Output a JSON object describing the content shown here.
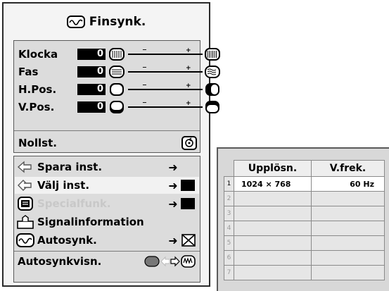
{
  "menu": {
    "title": "Finsynk.",
    "adjustments": [
      {
        "label": "Klocka",
        "value": "0"
      },
      {
        "label": "Fas",
        "value": "0"
      },
      {
        "label": "H.Pos.",
        "value": "0"
      },
      {
        "label": "V.Pos.",
        "value": "0"
      }
    ],
    "slider_minus": "−",
    "slider_plus": "+",
    "reset_label": "Nollst.",
    "items": [
      {
        "label": "Spara inst.",
        "arrow": "➜"
      },
      {
        "label": "Välj inst.",
        "arrow": "➜"
      },
      {
        "label": "Specialfunk.",
        "arrow": "➜",
        "disabled": true
      },
      {
        "label": "Signalinformation"
      },
      {
        "label": "Autosynk.",
        "arrow": "➜"
      },
      {
        "label": "Autosynkvisn."
      }
    ]
  },
  "resolution_table": {
    "headers": [
      "Upplösn.",
      "V.frek."
    ],
    "rows": [
      {
        "num": "1",
        "resolution": "1024 × 768",
        "frequency": "60 Hz"
      },
      {
        "num": "2",
        "resolution": "",
        "frequency": ""
      },
      {
        "num": "3",
        "resolution": "",
        "frequency": ""
      },
      {
        "num": "4",
        "resolution": "",
        "frequency": ""
      },
      {
        "num": "5",
        "resolution": "",
        "frequency": ""
      },
      {
        "num": "6",
        "resolution": "",
        "frequency": ""
      },
      {
        "num": "7",
        "resolution": "",
        "frequency": ""
      }
    ]
  },
  "colors": {
    "highlight_value": "#000000",
    "panel": "#dcdcdc"
  },
  "icons": {
    "title": "fine-sync-icon",
    "reset": "reset-icon",
    "save": "save-arrow-icon",
    "select": "select-arrow-icon",
    "special": "special-mode-icon",
    "signal": "signal-info-icon",
    "autosync": "autosync-icon",
    "autosync_display": "autosync-display-icon"
  }
}
